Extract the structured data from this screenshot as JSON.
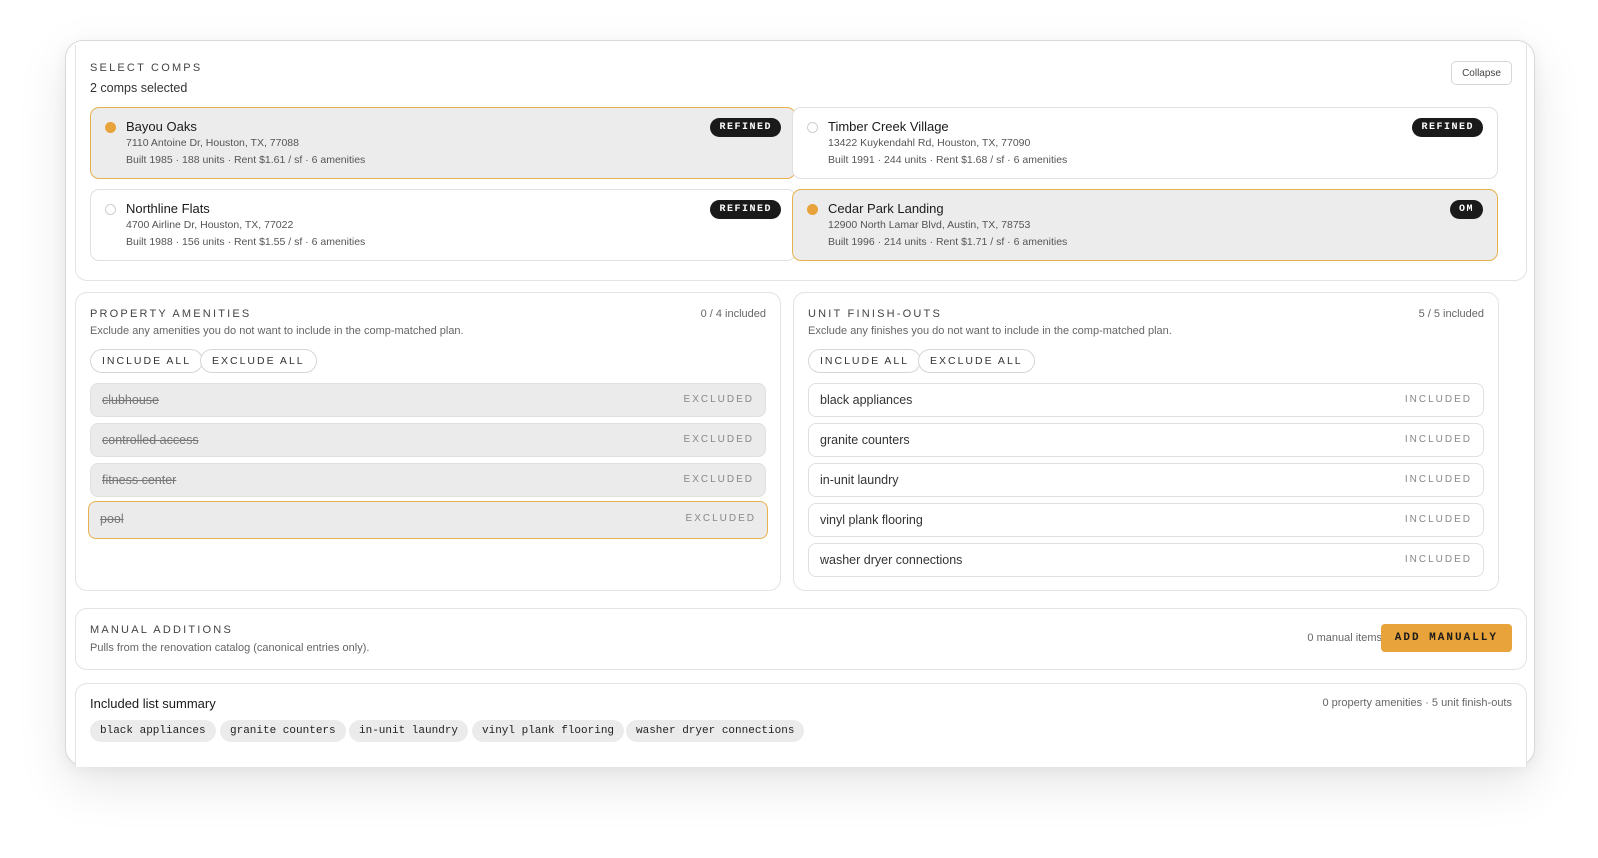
{
  "select_comps": {
    "title": "SELECT COMPS",
    "subtitle": "2 comps selected",
    "collapse_label": "Collapse",
    "comps": [
      {
        "name": "Bayou Oaks",
        "address": "7110 Antoine Dr, Houston, TX, 77088",
        "meta": "Built 1985 · 188 units · Rent $1.61 / sf · 6 amenities",
        "tag": "REFINED",
        "selected": true
      },
      {
        "name": "Timber Creek Village",
        "address": "13422 Kuykendahl Rd, Houston, TX, 77090",
        "meta": "Built 1991 · 244 units · Rent $1.68 / sf · 6 amenities",
        "tag": "REFINED",
        "selected": false
      },
      {
        "name": "Northline Flats",
        "address": "4700 Airline Dr, Houston, TX, 77022",
        "meta": "Built 1988 · 156 units · Rent $1.55 / sf · 6 amenities",
        "tag": "REFINED",
        "selected": false
      },
      {
        "name": "Cedar Park Landing",
        "address": "12900 North Lamar Blvd, Austin, TX, 78753",
        "meta": "Built 1996 · 214 units · Rent $1.71 / sf · 6 amenities",
        "tag": "OM",
        "selected": true
      }
    ]
  },
  "amenities": {
    "title": "PROPERTY AMENITIES",
    "count": "0 / 4 included",
    "description": "Exclude any amenities you do not want to include in the comp-matched plan.",
    "include_all": "INCLUDE ALL",
    "exclude_all": "EXCLUDE ALL",
    "items": [
      {
        "label": "clubhouse",
        "state": "EXCLUDED"
      },
      {
        "label": "controlled access",
        "state": "EXCLUDED"
      },
      {
        "label": "fitness center",
        "state": "EXCLUDED"
      },
      {
        "label": "pool",
        "state": "EXCLUDED"
      }
    ]
  },
  "finishes": {
    "title": "UNIT FINISH-OUTS",
    "count": "5 / 5 included",
    "description": "Exclude any finishes you do not want to include in the comp-matched plan.",
    "include_all": "INCLUDE ALL",
    "exclude_all": "EXCLUDE ALL",
    "items": [
      {
        "label": "black appliances",
        "state": "INCLUDED"
      },
      {
        "label": "granite counters",
        "state": "INCLUDED"
      },
      {
        "label": "in-unit laundry",
        "state": "INCLUDED"
      },
      {
        "label": "vinyl plank flooring",
        "state": "INCLUDED"
      },
      {
        "label": "washer dryer connections",
        "state": "INCLUDED"
      }
    ]
  },
  "manual": {
    "title": "MANUAL ADDITIONS",
    "description": "Pulls from the renovation catalog (canonical entries only).",
    "count": "0 manual items",
    "add_label": "ADD MANUALLY"
  },
  "summary": {
    "title": "Included list summary",
    "counts": "0 property amenities · 5 unit finish-outs",
    "chips": [
      "black appliances",
      "granite counters",
      "in-unit laundry",
      "vinyl plank flooring",
      "washer dryer connections"
    ]
  },
  "colors": {
    "accent": "#e8a33a",
    "selected_bg": "#ececec",
    "tag_bg": "#1a1a1a"
  }
}
